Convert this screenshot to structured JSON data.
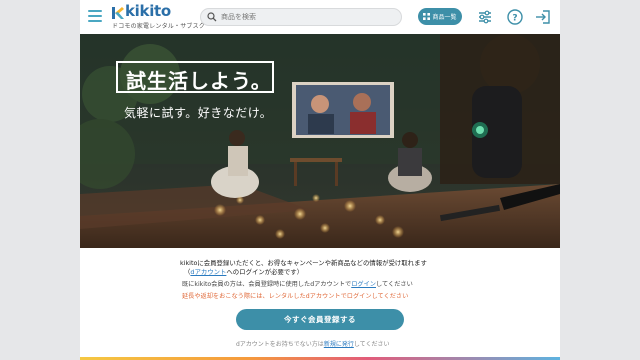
{
  "header": {
    "menu_icon": "hamburger-icon",
    "logo_text": "kikito",
    "logo_tagline": "ドコモの家電レンタル・サブスク",
    "search_placeholder": "商品を検索",
    "catalog_button_label": "商品一覧",
    "icons": [
      "filter-icon",
      "help-icon",
      "login-icon"
    ],
    "accent_color": "#3d8fa8"
  },
  "hero": {
    "headline": "試生活しよう。",
    "subline": "気軽に試す。好きなだけ。"
  },
  "content": {
    "message_line1": "kikitoに会員登録いただくと、お得なキャンペーンや新商品などの情報が受け取れます",
    "message_line2_prefix": "（",
    "message_line2_link": "dアカウント",
    "message_line2_suffix": "へのログインが必要です）",
    "existing_prefix": "既にkikito会員の方は、会員登録時に使用したdアカウントで",
    "existing_link": "ログイン",
    "existing_suffix": "してください",
    "warning_text": "延長や返却をおこなう際には、レンタルしたdアカウントでログインしてください",
    "register_button_label": "今すぐ会員登録する",
    "no_account_prefix": "dアカウントをお持ちでない方は",
    "no_account_link": "新規に発行",
    "no_account_suffix": "してください"
  }
}
